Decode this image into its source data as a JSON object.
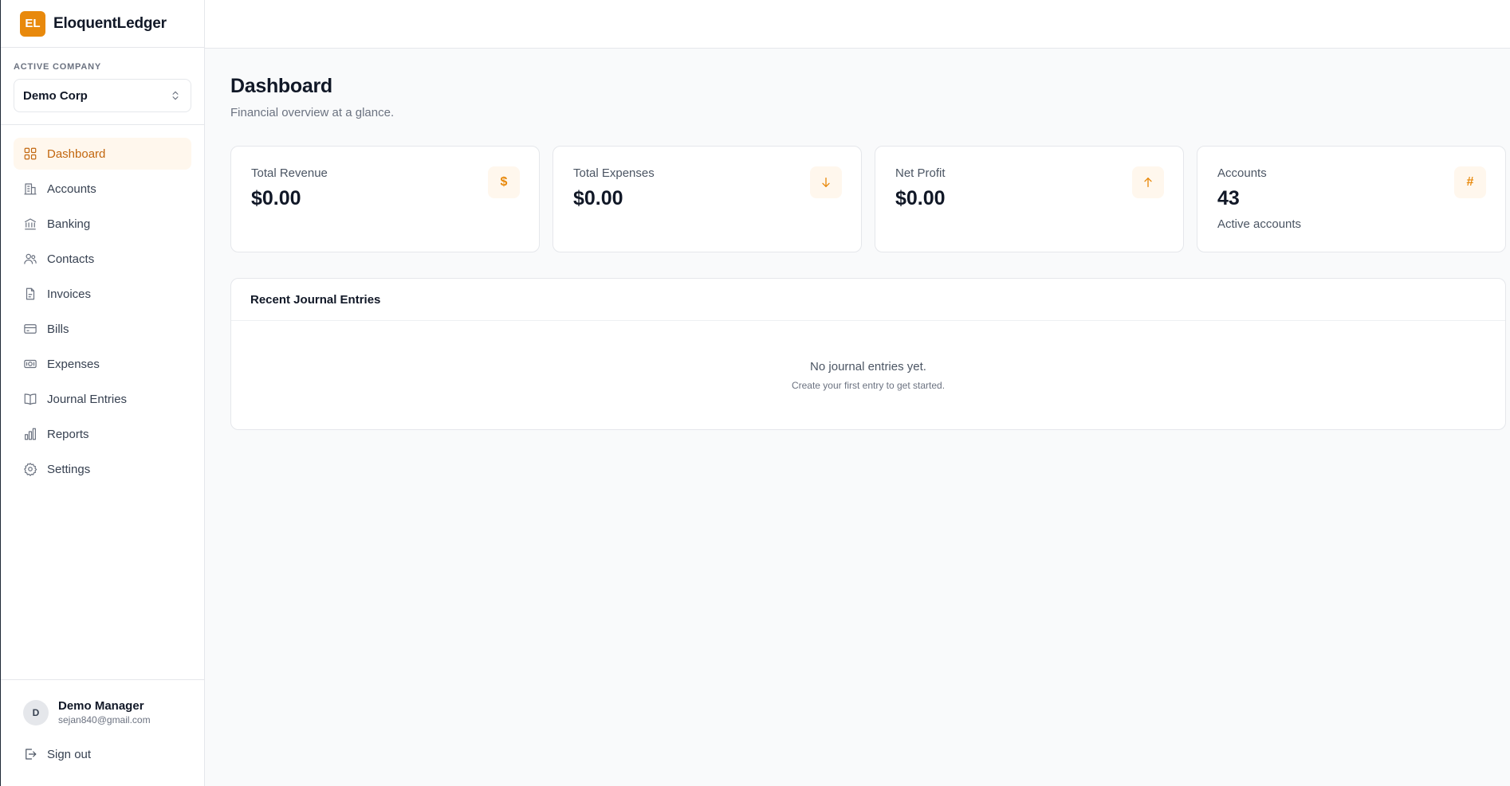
{
  "brand": {
    "logo_text": "EL",
    "name": "EloquentLedger",
    "accent_color": "#e8890c"
  },
  "company": {
    "label": "ACTIVE COMPANY",
    "selected": "Demo Corp"
  },
  "nav": {
    "items": [
      {
        "label": "Dashboard",
        "icon": "dashboard-grid-icon",
        "active": true
      },
      {
        "label": "Accounts",
        "icon": "building-icon"
      },
      {
        "label": "Banking",
        "icon": "bank-icon"
      },
      {
        "label": "Contacts",
        "icon": "users-icon"
      },
      {
        "label": "Invoices",
        "icon": "file-icon"
      },
      {
        "label": "Bills",
        "icon": "credit-card-icon"
      },
      {
        "label": "Expenses",
        "icon": "banknote-icon"
      },
      {
        "label": "Journal Entries",
        "icon": "book-icon"
      },
      {
        "label": "Reports",
        "icon": "bar-chart-icon"
      },
      {
        "label": "Settings",
        "icon": "gear-icon"
      }
    ]
  },
  "user": {
    "initial": "D",
    "name": "Demo Manager",
    "email": "sejan840@gmail.com"
  },
  "signout_label": "Sign out",
  "page": {
    "title": "Dashboard",
    "subtitle": "Financial overview at a glance."
  },
  "stats": [
    {
      "label": "Total Revenue",
      "value": "$0.00",
      "icon": "dollar-icon"
    },
    {
      "label": "Total Expenses",
      "value": "$0.00",
      "icon": "arrow-down-icon"
    },
    {
      "label": "Net Profit",
      "value": "$0.00",
      "icon": "arrow-up-icon"
    },
    {
      "label": "Accounts",
      "value": "43",
      "sub": "Active accounts",
      "icon": "hash-icon"
    }
  ],
  "journal": {
    "title": "Recent Journal Entries",
    "empty_title": "No journal entries yet.",
    "empty_sub": "Create your first entry to get started."
  }
}
